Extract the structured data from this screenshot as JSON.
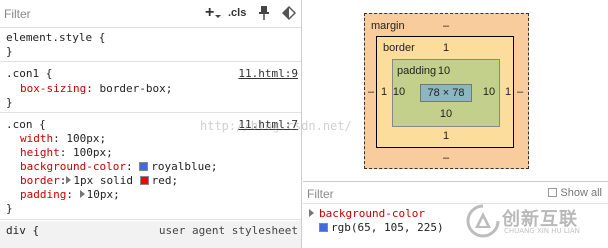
{
  "styles_pane": {
    "filter_placeholder": "Filter",
    "toolbar": {
      "add_rule": "+",
      "cls": ".cls"
    },
    "element_style": {
      "selector": "element.style {",
      "close": "}"
    },
    "rule_con1": {
      "selector": ".con1 {",
      "source": "11.html:9",
      "declarations": [
        {
          "prop": "box-sizing",
          "value": "border-box;"
        }
      ],
      "close": "}"
    },
    "rule_con": {
      "selector": ".con {",
      "source": "11.html:7",
      "decl_width": {
        "prop": "width",
        "value": "100px;"
      },
      "decl_height": {
        "prop": "height",
        "value": "100px;"
      },
      "decl_bg": {
        "prop": "background-color",
        "value": "royalblue;",
        "swatch": "#4169e1"
      },
      "decl_border": {
        "prop": "border",
        "value": "1px solid",
        "value2": "red;",
        "swatch": "#ff0000"
      },
      "decl_padding": {
        "prop": "padding",
        "value": "10px;"
      },
      "close": "}"
    },
    "ua_rule": {
      "selector": "div {",
      "source": "user agent stylesheet"
    }
  },
  "computed_pane": {
    "box_model": {
      "margin_label": "margin",
      "margin_top": "–",
      "margin_bottom": "–",
      "margin_left": "–",
      "margin_right": "–",
      "border_label": "border",
      "border_top": "1",
      "border_bottom": "1",
      "border_left": "1",
      "border_right": "1",
      "padding_label": "padding",
      "padding_top": "10",
      "padding_bottom": "10",
      "padding_left": "10",
      "padding_right": "10",
      "content": "78 × 78"
    },
    "filter_placeholder": "Filter",
    "show_all": "Show all",
    "property": {
      "name": "background-color",
      "value": "rgb(65, 105, 225)",
      "swatch": "#4169e1"
    }
  },
  "watermark": {
    "text": "http://blog.csdn.net/"
  },
  "logo": {
    "name": "创新互联",
    "sub": "CHUANG XIN HU LIAN",
    "accent": "#bdbdbd"
  }
}
